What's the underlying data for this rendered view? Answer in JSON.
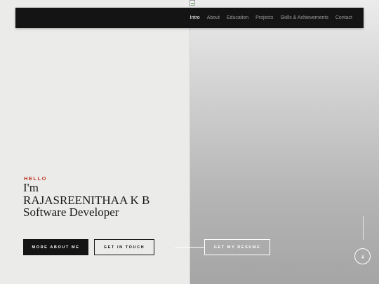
{
  "nav": {
    "items": [
      {
        "label": "Intro",
        "active": true
      },
      {
        "label": "About",
        "active": false
      },
      {
        "label": "Education",
        "active": false
      },
      {
        "label": "Projects",
        "active": false
      },
      {
        "label": "Skills & Achievements",
        "active": false
      },
      {
        "label": "Contact",
        "active": false
      }
    ]
  },
  "hero": {
    "greeting": "HELLO",
    "line1": "I'm",
    "name": "RAJASREENITHAA K B",
    "role": "Software Developer"
  },
  "buttons": {
    "about": "MORE ABOUT ME",
    "touch": "GET IN TOUCH",
    "resume": "GET MY RESUME"
  },
  "colors": {
    "accent": "#c0392b",
    "navbar": "#141414",
    "nav_active": "#ffffff",
    "nav_inactive": "#9a9a9a"
  },
  "icons": {
    "scroll_down": "arrow-down-icon",
    "broken_image": "broken-image-icon"
  }
}
